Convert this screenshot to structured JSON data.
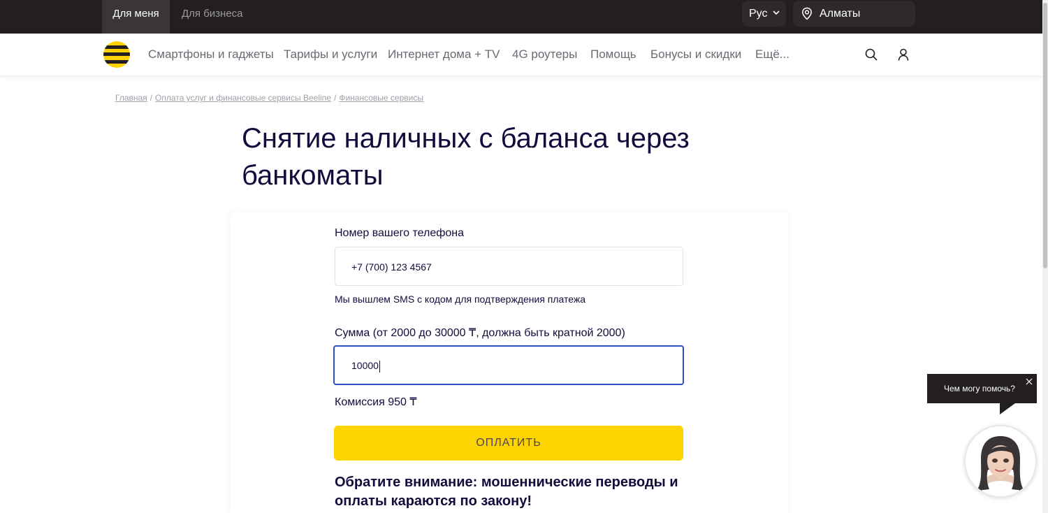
{
  "topbar": {
    "tabs": [
      "Для меня",
      "Для бизнеса"
    ],
    "language": "Рус",
    "city": "Алматы"
  },
  "nav": {
    "items": [
      "Смартфоны и гаджеты",
      "Тарифы и услуги",
      "Интернет дома + TV",
      "4G роутеры",
      "Помощь",
      "Бонусы и скидки",
      "Ещё..."
    ]
  },
  "breadcrumb": [
    "Главная",
    "Оплата услуг и финансовые сервисы Beeline",
    "Финансовые сервисы"
  ],
  "page": {
    "title": "Снятие наличных с баланса через банкоматы"
  },
  "form": {
    "phone_label": "Номер вашего телефона",
    "phone_value": "+7 (700) 123 4567",
    "sms_hint": "Мы вышлем SMS с кодом для подтверждения платежа",
    "amount_label": "Сумма (от 2000 до 30000 ₸, должна быть кратной 2000)",
    "amount_value": "10000",
    "commission": "Комиссия 950 ₸",
    "pay_button": "ОПЛАТИТЬ",
    "warning": "Обратите внимание: мошеннические переводы и оплаты караются по закону!"
  },
  "chat": {
    "prompt": "Чем могу помочь?"
  },
  "colors": {
    "brand_yellow": "#fed400",
    "dark": "#231f20",
    "text_primary": "#140a3c",
    "focus_border": "#2a52be"
  }
}
